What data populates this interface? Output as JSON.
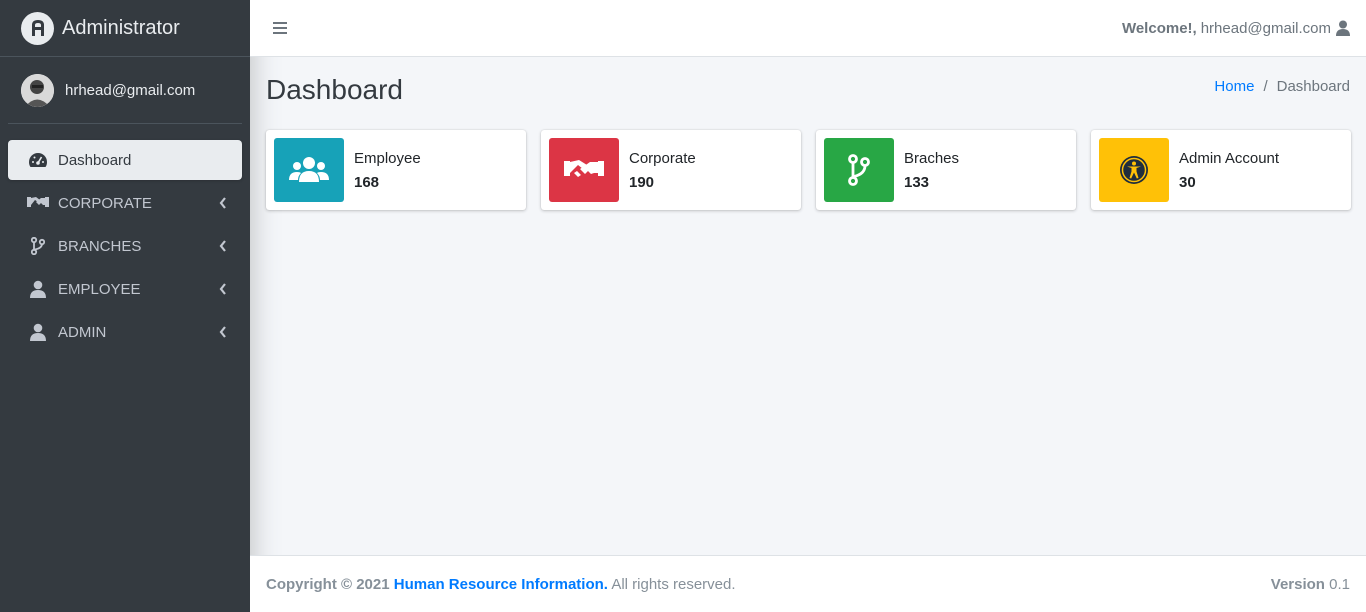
{
  "brand": {
    "name": "Administrator"
  },
  "user": {
    "email": "hrhead@gmail.com"
  },
  "sidebar": {
    "items": [
      {
        "label": "Dashboard"
      },
      {
        "label": "CORPORATE"
      },
      {
        "label": "BRANCHES"
      },
      {
        "label": "EMPLOYEE"
      },
      {
        "label": "ADMIN"
      }
    ]
  },
  "topbar": {
    "welcome": "Welcome!,",
    "user": "hrhead@gmail.com"
  },
  "page": {
    "title": "Dashboard"
  },
  "breadcrumb": {
    "home": "Home",
    "sep": "/",
    "current": "Dashboard"
  },
  "cards": [
    {
      "label": "Employee",
      "value": "168",
      "color": "#17a2b8"
    },
    {
      "label": "Corporate",
      "value": "190",
      "color": "#dc3545"
    },
    {
      "label": "Braches",
      "value": "133",
      "color": "#28a745"
    },
    {
      "label": "Admin Account",
      "value": "30",
      "color": "#ffc107"
    }
  ],
  "footer": {
    "copyright": "Copyright © 2021",
    "org": "Human Resource Information.",
    "rights": "All rights reserved.",
    "version_label": "Version",
    "version": "0.1"
  }
}
